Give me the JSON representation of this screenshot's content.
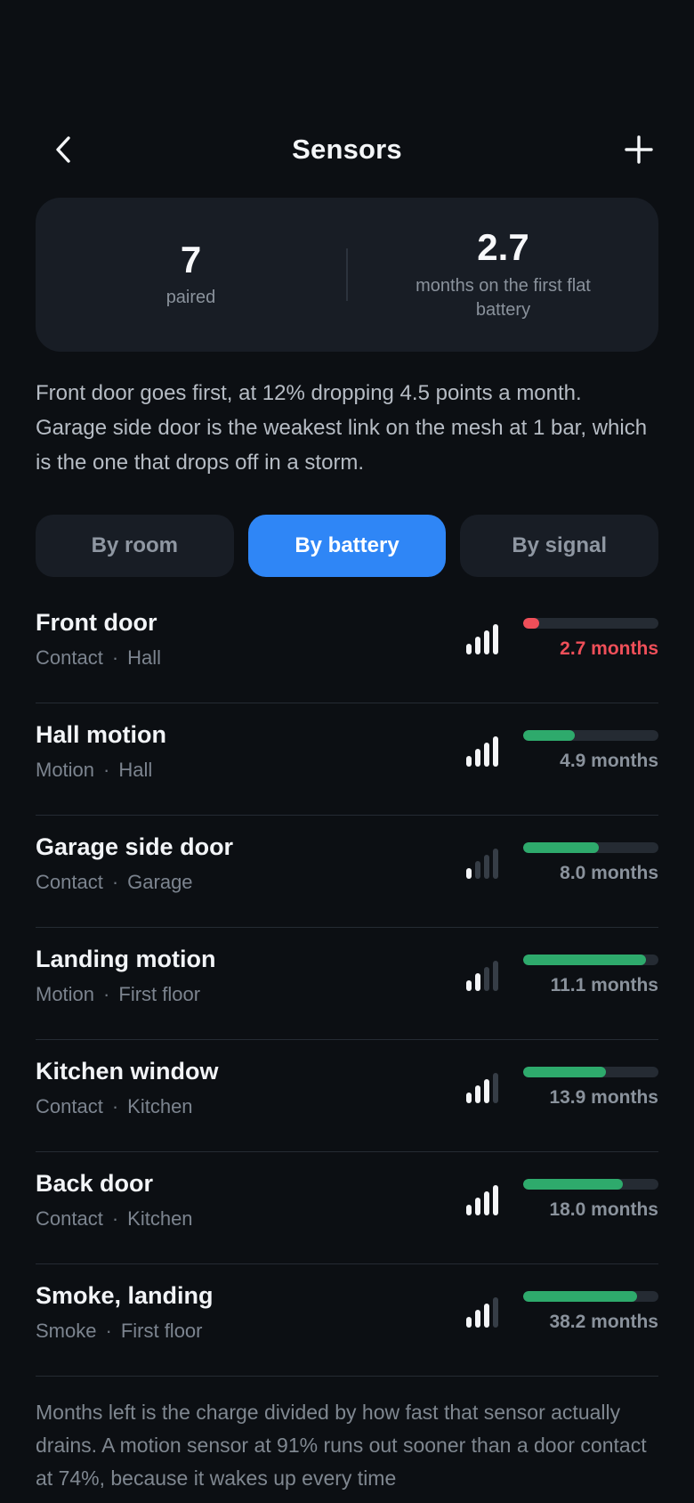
{
  "header": {
    "title": "Sensors",
    "back_icon": "chevron-left-icon",
    "add_icon": "plus-icon"
  },
  "summary": {
    "paired_count": "7",
    "paired_label": "paired",
    "months_value": "2.7",
    "months_label": "months on the first flat battery"
  },
  "insight": "Front door goes first, at 12% dropping 4.5 points a month. Garage side door is the weakest link on the mesh at 1 bar, which is the one that drops off in a storm.",
  "tabs": [
    {
      "label": "By room",
      "active": false
    },
    {
      "label": "By battery",
      "active": true
    },
    {
      "label": "By signal",
      "active": false
    }
  ],
  "sensors": [
    {
      "name": "Front door",
      "type": "Contact",
      "room": "Hall",
      "signal_bars": 4,
      "battery_fraction": 0.12,
      "months": "2.7 months",
      "low": true
    },
    {
      "name": "Hall motion",
      "type": "Motion",
      "room": "Hall",
      "signal_bars": 4,
      "battery_fraction": 0.38,
      "months": "4.9 months",
      "low": false
    },
    {
      "name": "Garage side door",
      "type": "Contact",
      "room": "Garage",
      "signal_bars": 1,
      "battery_fraction": 0.56,
      "months": "8.0 months",
      "low": false
    },
    {
      "name": "Landing motion",
      "type": "Motion",
      "room": "First floor",
      "signal_bars": 2,
      "battery_fraction": 0.91,
      "months": "11.1 months",
      "low": false
    },
    {
      "name": "Kitchen window",
      "type": "Contact",
      "room": "Kitchen",
      "signal_bars": 3,
      "battery_fraction": 0.61,
      "months": "13.9 months",
      "low": false
    },
    {
      "name": "Back door",
      "type": "Contact",
      "room": "Kitchen",
      "signal_bars": 4,
      "battery_fraction": 0.74,
      "months": "18.0 months",
      "low": false
    },
    {
      "name": "Smoke, landing",
      "type": "Smoke",
      "room": "First floor",
      "signal_bars": 3,
      "battery_fraction": 0.84,
      "months": "38.2 months",
      "low": false
    }
  ],
  "meta_separator": "·",
  "footnote": "Months left is the charge divided by how fast that sensor actually drains. A motion sensor at 91% runs out sooner than a door contact at 74%, because it wakes up every time",
  "colors": {
    "accent": "#2f86f6",
    "good": "#2eaa6c",
    "low": "#ef4f59",
    "background": "#0c0f13",
    "card": "#181d25"
  }
}
